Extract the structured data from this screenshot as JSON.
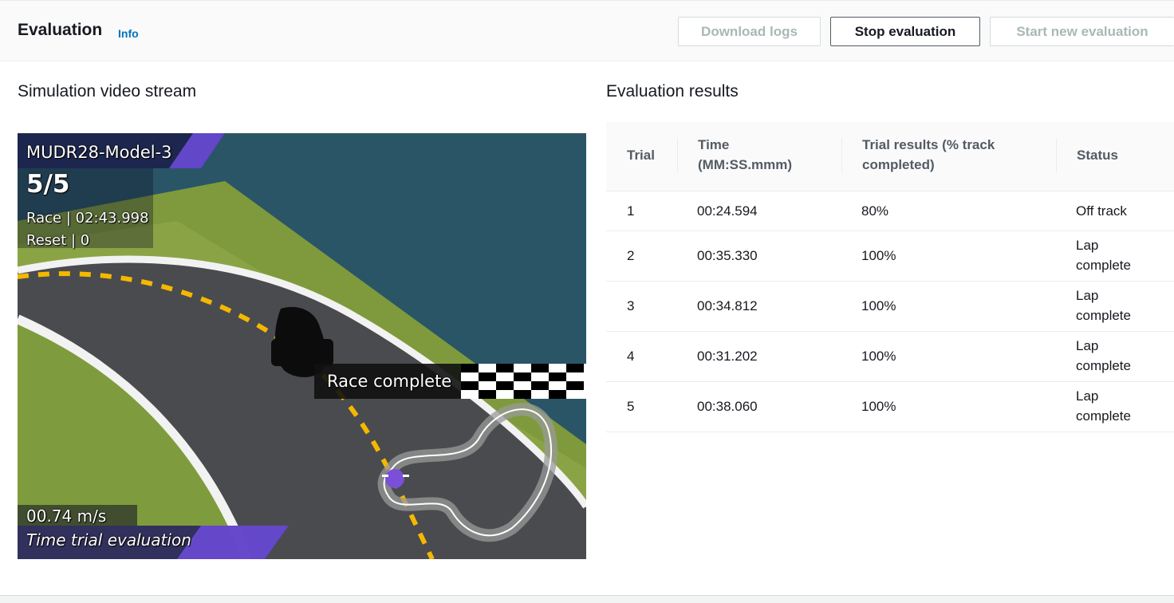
{
  "header": {
    "title": "Evaluation",
    "info_label": "Info",
    "buttons": {
      "download_logs": "Download logs",
      "stop_evaluation": "Stop evaluation",
      "start_new_evaluation": "Start new evaluation"
    }
  },
  "simulation": {
    "section_title": "Simulation video stream",
    "overlay": {
      "model_name": "MUDR28-Model-3",
      "lap_count": "5/5",
      "race_time": "Race | 02:43.998",
      "reset_count": "Reset | 0",
      "banner": "Race complete",
      "speed": "00.74 m/s",
      "mode": "Time trial evaluation"
    }
  },
  "results": {
    "section_title": "Evaluation results",
    "columns": {
      "trial": "Trial",
      "time_line1": "Time",
      "time_line2": "(MM:SS.mmm)",
      "result_line1": "Trial results (% track",
      "result_line2": "completed)",
      "status": "Status"
    },
    "rows": [
      {
        "trial": "1",
        "time": "00:24.594",
        "result": "80%",
        "status_line1": "Off track",
        "status_line2": ""
      },
      {
        "trial": "2",
        "time": "00:35.330",
        "result": "100%",
        "status_line1": "Lap",
        "status_line2": "complete"
      },
      {
        "trial": "3",
        "time": "00:34.812",
        "result": "100%",
        "status_line1": "Lap",
        "status_line2": "complete"
      },
      {
        "trial": "4",
        "time": "00:31.202",
        "result": "100%",
        "status_line1": "Lap",
        "status_line2": "complete"
      },
      {
        "trial": "5",
        "time": "00:38.060",
        "result": "100%",
        "status_line1": "Lap",
        "status_line2": "complete"
      }
    ]
  }
}
